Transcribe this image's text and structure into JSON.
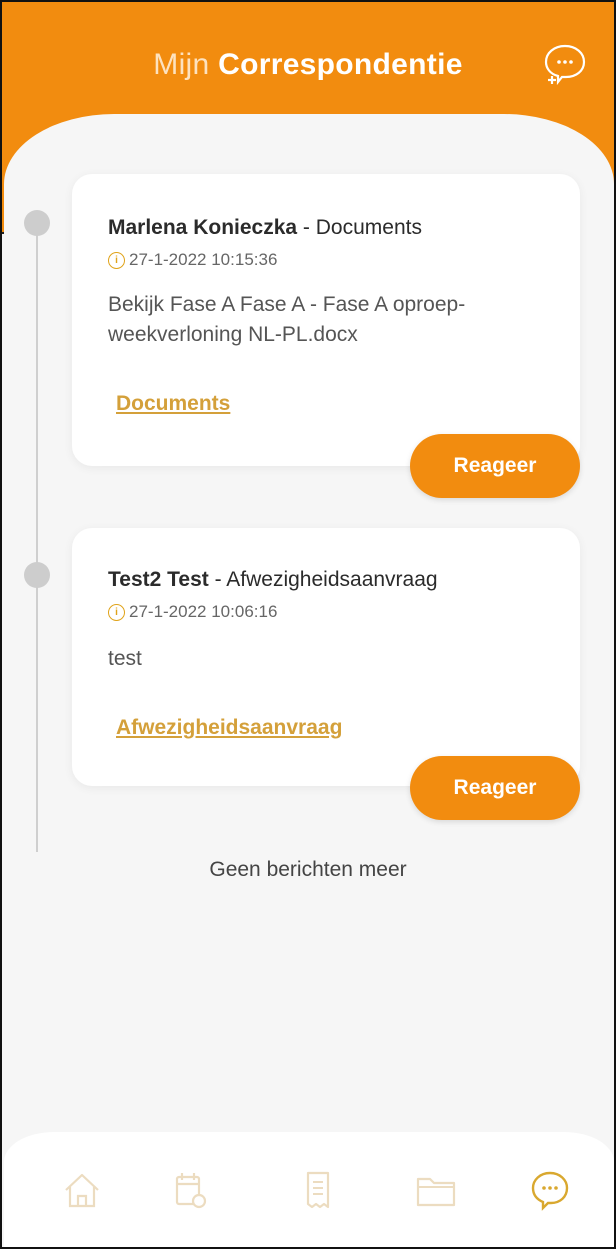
{
  "header": {
    "title_light": "Mijn",
    "title_bold": "Correspondentie",
    "new_message_icon": "chat-plus-icon"
  },
  "messages": [
    {
      "name": "Marlena Konieczka",
      "separator": " - ",
      "type": "Documents",
      "date": "27-1-2022 10:15:36",
      "body": "Bekijk Fase A Fase A - Fase A oproep-weekverloning NL-PL.docx",
      "link": "Documents",
      "reply_label": "Reageer"
    },
    {
      "name": "Test2 Test",
      "separator": " - ",
      "type": "Afwezigheidsaanvraag",
      "date": "27-1-2022 10:06:16",
      "body": "test",
      "link": "Afwezigheidsaanvraag",
      "reply_label": "Reageer"
    }
  ],
  "no_more_label": "Geen berichten meer",
  "bottom_nav": {
    "items": [
      {
        "icon": "home-icon",
        "active": false
      },
      {
        "icon": "calendar-icon",
        "active": false
      },
      {
        "icon": "receipt-icon",
        "active": false
      },
      {
        "icon": "folder-icon",
        "active": false
      },
      {
        "icon": "chat-icon",
        "active": true
      }
    ]
  },
  "colors": {
    "accent": "#f28c0f",
    "link": "#d4a03a",
    "inactive_icon": "#ecdcc0",
    "active_icon": "#d9a82f"
  }
}
